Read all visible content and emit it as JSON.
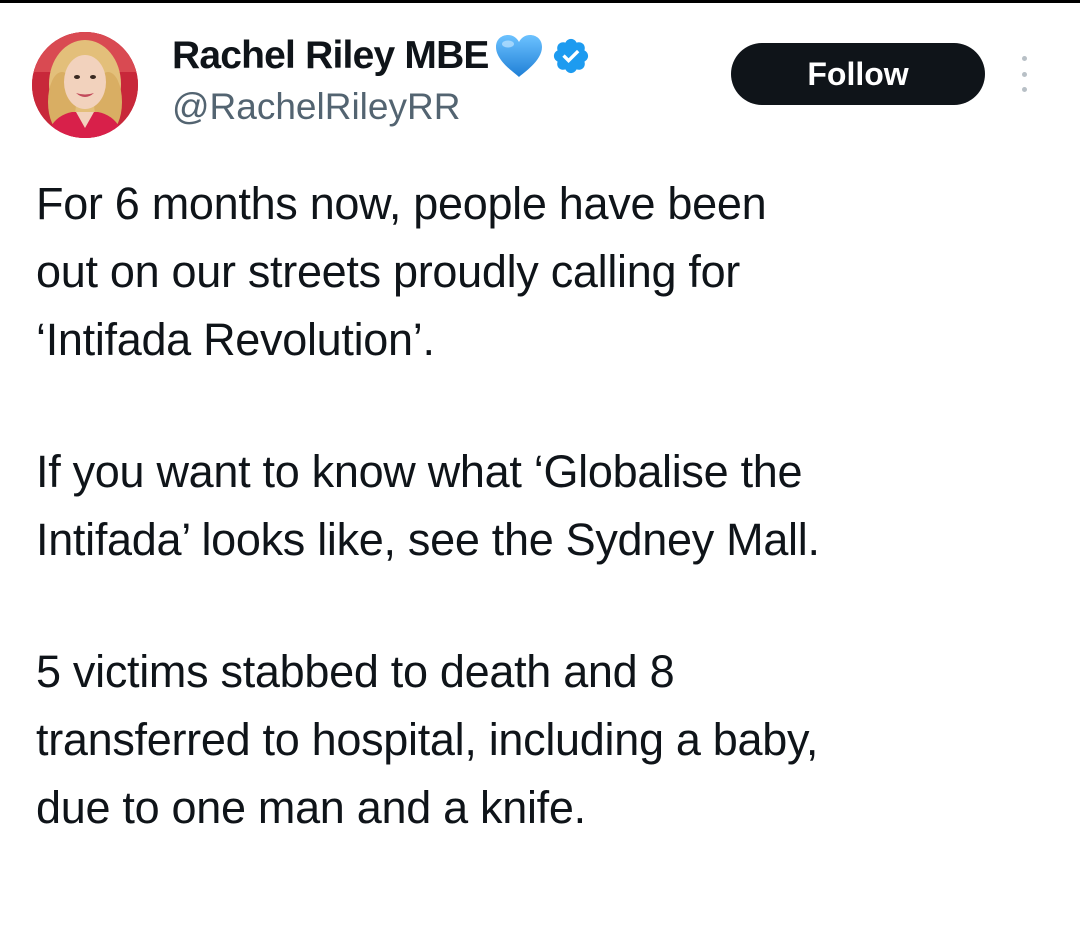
{
  "author": {
    "display_name": "Rachel Riley MBE",
    "handle": "@RachelRileyRR",
    "avatar": "avatar-photo",
    "badges": [
      "blue-heart-icon",
      "verified-badge-icon"
    ],
    "verified_color": "#1d9bf0",
    "heart_color": "#2f9ff0"
  },
  "actions": {
    "follow_label": "Follow",
    "more_icon": "more-options-icon"
  },
  "tweet": {
    "paragraphs": [
      {
        "lines": [
          "For 6 months now, people have been",
          "out on our streets proudly calling for",
          "‘Intifada Revolution’."
        ]
      },
      {
        "lines": [
          "If you want to know what ‘Globalise the",
          "Intifada’ looks like, see the Sydney Mall."
        ]
      },
      {
        "lines": [
          "5 victims stabbed to death and 8",
          "transferred to hospital, including a baby,",
          "due to one man and a knife."
        ]
      }
    ]
  },
  "colors": {
    "text_primary": "#0f1419",
    "text_secondary": "#536471",
    "button_bg": "#0f1419",
    "button_text": "#ffffff"
  }
}
